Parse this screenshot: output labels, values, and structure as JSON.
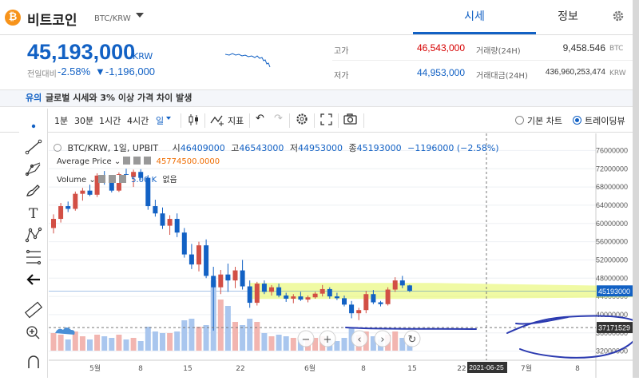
{
  "header": {
    "coin_symbol": "₿",
    "coin_name": "비트코인",
    "pair": "BTC/KRW",
    "tabs": [
      "시세",
      "정보"
    ]
  },
  "summary": {
    "price": "45,193,000",
    "price_unit": "KRW",
    "change_label": "전일대비",
    "change_pct": "-2.58%",
    "change_amt": "▼-1,196,000",
    "high_label": "고가",
    "high_value": "46,543,000",
    "low_label": "저가",
    "low_value": "44,953,000",
    "vol_label": "거래량(24H)",
    "vol_value": "9,458.546",
    "vol_unit": "BTC",
    "amount_label": "거래대금(24H)",
    "amount_value": "436,960,253,474",
    "amount_unit": "KRW"
  },
  "notice": {
    "tag": "유의",
    "text": "글로벌 시세와 3% 이상 가격 차이 발생"
  },
  "toolbar": {
    "intervals": [
      "1분",
      "30분",
      "1시간",
      "4시간",
      "일"
    ],
    "indicator": "지표",
    "chart_modes": [
      "기본 차트",
      "트레이딩뷰"
    ]
  },
  "chart_legend": {
    "symbol": "BTC/KRW, 1일, UPBIT",
    "open_label": "시",
    "open": "46409000",
    "high_label": "고",
    "high": "46543000",
    "low_label": "저",
    "low": "44953000",
    "close_label": "종",
    "close": "45193000",
    "change": "−1196000 (−2.58%)",
    "ma_label": "Average Price",
    "ma_value": "45774500.0000",
    "vol_label": "Volume",
    "vol_value": "5.00 K",
    "vol_extra": "없음"
  },
  "colors": {
    "up": "#d24f45",
    "down": "#1261c4",
    "accent": "#1261c4",
    "vol_up": "#f2b5b0",
    "vol_down": "#a9c6ee",
    "highlight": "#e4f55a",
    "scribble": "#2b3ab0"
  },
  "chart_data": {
    "type": "candlestick",
    "y_ticks": [
      "76000000",
      "72000000",
      "68000000",
      "64000000",
      "60000000",
      "56000000",
      "52000000",
      "48000000",
      "44000000",
      "40000000",
      "36000000",
      "32000000"
    ],
    "ylim": [
      30000000,
      78000000
    ],
    "x_ticks": [
      "5월",
      "8",
      "15",
      "22",
      "6월",
      "8",
      "15",
      "22",
      "2021-06-25",
      "7월",
      "8"
    ],
    "price_tag": "45193000",
    "crosshair_tag": "37171529",
    "candles": [
      [
        59000000,
        62000000,
        57800000,
        61000000
      ],
      [
        61000000,
        64500000,
        60200000,
        63800000
      ],
      [
        63800000,
        64800000,
        62500000,
        63200000
      ],
      [
        63200000,
        67000000,
        62800000,
        66500000
      ],
      [
        66500000,
        67800000,
        65000000,
        67200000
      ],
      [
        67200000,
        68500000,
        66000000,
        66300000
      ],
      [
        66300000,
        71000000,
        65800000,
        70500000
      ],
      [
        70500000,
        71500000,
        68500000,
        69000000
      ],
      [
        69000000,
        70200000,
        66800000,
        67200000
      ],
      [
        67200000,
        71200000,
        66900000,
        70800000
      ],
      [
        70800000,
        72000000,
        69200000,
        70200000
      ],
      [
        70200000,
        71800000,
        68000000,
        71300000
      ],
      [
        71300000,
        71900000,
        69500000,
        70000000
      ],
      [
        70000000,
        70600000,
        63000000,
        63800000
      ],
      [
        63800000,
        65200000,
        61500000,
        62200000
      ],
      [
        62200000,
        63500000,
        58800000,
        59500000
      ],
      [
        59500000,
        61800000,
        57500000,
        61000000
      ],
      [
        61000000,
        62200000,
        57000000,
        58000000
      ],
      [
        58000000,
        59000000,
        52500000,
        53200000
      ],
      [
        53200000,
        55500000,
        50000000,
        51000000
      ],
      [
        51000000,
        56000000,
        49500000,
        55200000
      ],
      [
        55200000,
        56500000,
        48000000,
        48500000
      ],
      [
        48500000,
        50500000,
        36500000,
        46000000
      ],
      [
        46000000,
        49800000,
        44500000,
        48800000
      ],
      [
        48800000,
        51200000,
        45000000,
        47500000
      ],
      [
        47500000,
        50500000,
        45800000,
        49700000
      ],
      [
        49700000,
        52000000,
        45500000,
        46200000
      ],
      [
        46200000,
        47500000,
        41500000,
        42600000
      ],
      [
        42600000,
        47200000,
        42000000,
        46800000
      ],
      [
        46800000,
        47500000,
        44500000,
        45000000
      ],
      [
        45000000,
        46500000,
        44200000,
        46000000
      ],
      [
        46000000,
        46800000,
        43800000,
        44200000
      ],
      [
        44200000,
        44800000,
        42800000,
        43500000
      ],
      [
        43500000,
        44500000,
        42500000,
        44000000
      ],
      [
        44000000,
        45000000,
        43000000,
        43300000
      ],
      [
        43300000,
        44200000,
        42700000,
        43800000
      ],
      [
        43800000,
        45000000,
        43500000,
        44600000
      ],
      [
        44600000,
        46500000,
        44000000,
        45600000
      ],
      [
        45600000,
        46000000,
        43500000,
        44000000
      ],
      [
        44000000,
        44800000,
        43200000,
        43600000
      ],
      [
        43600000,
        44200000,
        41800000,
        42200000
      ],
      [
        42200000,
        43000000,
        39200000,
        40300000
      ],
      [
        40300000,
        41500000,
        38800000,
        41000000
      ],
      [
        41000000,
        45200000,
        40300000,
        44500000
      ],
      [
        44500000,
        45400000,
        42300000,
        42700000
      ],
      [
        42700000,
        43000000,
        41800000,
        42300000
      ],
      [
        42300000,
        46000000,
        42000000,
        45500000
      ],
      [
        45500000,
        48200000,
        45000000,
        47500000
      ],
      [
        47500000,
        48500000,
        45800000,
        46409000
      ],
      [
        46409000,
        46543000,
        44953000,
        45193000
      ]
    ],
    "volume_ratio": [
      0.55,
      0.5,
      0.35,
      0.6,
      0.45,
      0.35,
      0.5,
      0.45,
      0.4,
      0.5,
      0.35,
      0.4,
      0.3,
      0.75,
      0.6,
      0.55,
      0.55,
      0.6,
      0.95,
      1.0,
      0.75,
      0.8,
      2.2,
      1.6,
      1.4,
      0.9,
      0.8,
      1.0,
      0.9,
      0.55,
      0.45,
      0.5,
      0.45,
      0.4,
      0.35,
      0.35,
      0.4,
      0.45,
      0.35,
      0.3,
      0.4,
      0.7,
      0.5,
      0.6,
      0.45,
      0.35,
      0.5,
      0.6,
      0.4,
      0.2
    ]
  }
}
